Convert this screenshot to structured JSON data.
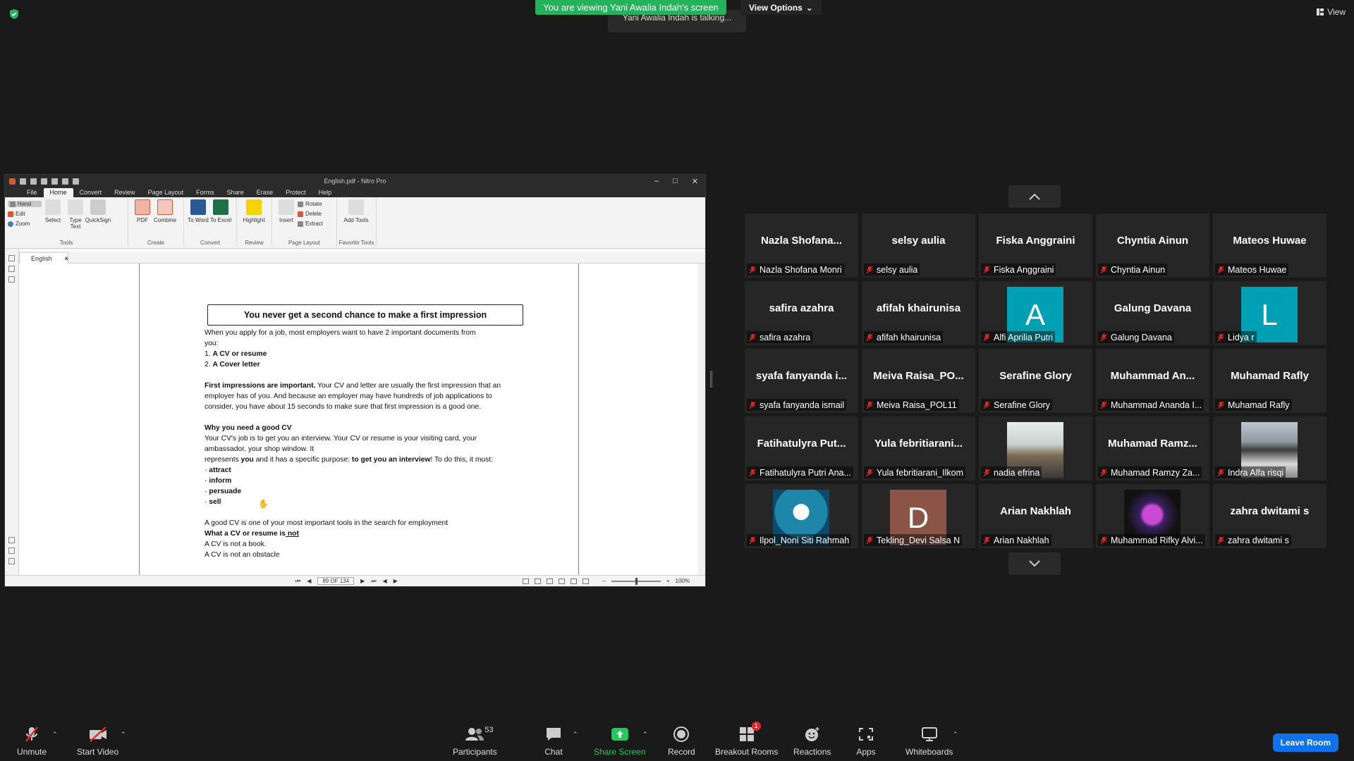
{
  "banner": {
    "viewing": "You are viewing Yani Awalia Indah's screen",
    "view_options": "View Options",
    "talking": "Yani Awalia Indah is talking...",
    "view": "View"
  },
  "nitro": {
    "title": "English.pdf - Nitro Pro",
    "menu_tabs": [
      "File",
      "Home",
      "Convert",
      "Review",
      "Page Layout",
      "Forms",
      "Share",
      "Erase",
      "Protect",
      "Help"
    ],
    "tools": {
      "hand": "Hand",
      "edit": "Edit",
      "zoom": "Zoom",
      "select": "Select",
      "type_text": "Type Text",
      "quicksign": "QuickSign",
      "tools_group": "Tools",
      "pdf": "PDF",
      "combine": "Combine",
      "create_group": "Create",
      "to_word": "To Word",
      "to_excel": "To Excel",
      "convert_group": "Convert",
      "highlight": "Highlight",
      "review_group": "Review",
      "insert": "Insert",
      "rotate": "Rotate",
      "delete": "Delete",
      "extract": "Extract",
      "page_layout_group": "Page Layout",
      "add_tools": "Add Tools",
      "favorite_group": "Favorite Tools"
    },
    "doc_tab": "English",
    "doc": {
      "heading": "You never get a second chance to make a first impression",
      "intro1": "When you apply for a job, most employers want to have 2 important documents from",
      "intro2": "you:",
      "item1_num": "1. ",
      "item1": "A CV or resume",
      "item2_num": "2. ",
      "item2": "A Cover letter",
      "fi_bold": "First impressions are important.",
      "fi_rest": " Your CV and letter are usually the first impression that an",
      "fi2": "employer has of you. And because an employer may have hundreds of job applications to",
      "fi3": "consider, you have about 15 seconds to make sure that first impression is a good one.",
      "why": "Why you need a good CV",
      "why1": "Your CV's job is to get you an interview. Your CV or resume is your visiting card, your",
      "why2": "ambassador, your shop window. It",
      "why3a": "represents ",
      "why3b": "you",
      "why3c": " and it has a specific purpose: ",
      "why3d": "to get you an interview",
      "why3e": "! To do this, it must:",
      "b1": "attract",
      "b2": "inform",
      "b3": "persuade",
      "b4": "sell",
      "good_cv": "A good CV is one of your most important tools in the search for employment",
      "what_a": "What a CV or resume is",
      "what_b": " not",
      "not_book": "A CV is not a book.",
      "not_obstacle": "A CV is not an obstacle"
    },
    "status": {
      "page": "89 OF 134",
      "zoom": "100%"
    }
  },
  "participants_tiles": [
    {
      "display": "Nazla  Shofana...",
      "label": "Nazla Shofana Monri"
    },
    {
      "display": "selsy aulia",
      "label": "selsy aulia"
    },
    {
      "display": "Fiska Anggraini",
      "label": "Fiska Anggraini"
    },
    {
      "display": "Chyntia Ainun",
      "label": "Chyntia Ainun"
    },
    {
      "display": "Mateos Huwae",
      "label": "Mateos Huwae"
    },
    {
      "display": "safira azahra",
      "label": "safira azahra"
    },
    {
      "display": "afifah khairunisa",
      "label": "afifah khairunisa"
    },
    {
      "avatar": "A",
      "label": "Alfi Aprilia Putri"
    },
    {
      "display": "Galung Davana",
      "label": "Galung Davana"
    },
    {
      "avatar": "L",
      "label": "Lidya r"
    },
    {
      "display": "syafa fanyanda i...",
      "label": "syafa fanyanda ismail"
    },
    {
      "display": "Meiva  Raisa_PO...",
      "label": "Meiva Raisa_POL11"
    },
    {
      "display": "Serafine Glory",
      "label": "Serafine Glory"
    },
    {
      "display": "Muhammad  An...",
      "label": "Muhammad Ananda I..."
    },
    {
      "display": "Muhamad Rafly",
      "label": "Muhamad Rafly"
    },
    {
      "display": "Fatihatulyra  Put...",
      "label": "Fatihatulyra Putri Ana..."
    },
    {
      "display": "Yula  febritiarani...",
      "label": "Yula febritiarani_Ilkom"
    },
    {
      "photo": "photo-woman",
      "label": "nadia efrina"
    },
    {
      "display": "Muhamad  Ramz...",
      "label": "Muhamad Ramzy Za..."
    },
    {
      "photo": "photo-statue",
      "label": "Indra Alfa risqi"
    },
    {
      "photo": "photo-moon-city",
      "label": "Ilpol_Noni Siti Rahmah"
    },
    {
      "avatar": "D",
      "label": "Tekling_Devi Salsa N"
    },
    {
      "display": "Arian Nakhlah",
      "label": "Arian Nakhlah"
    },
    {
      "photo": "photo-skull",
      "label": "Muhammad Rifky Alvi..."
    },
    {
      "display": "zahra dwitami s",
      "label": "zahra dwitami s"
    }
  ],
  "toolbar": {
    "unmute": "Unmute",
    "start_video": "Start Video",
    "participants": "Participants",
    "participants_count": "53",
    "chat": "Chat",
    "share_screen": "Share Screen",
    "record": "Record",
    "breakout_rooms": "Breakout Rooms",
    "breakout_badge": "1",
    "reactions": "Reactions",
    "apps": "Apps",
    "whiteboards": "Whiteboards",
    "leave": "Leave Room"
  },
  "colors": {
    "green_banner": "#23b35b",
    "leave_blue": "#0e72ed",
    "avatar_teal": "#00a0b4",
    "avatar_brown": "#8c5446",
    "mic_red": "#e02828"
  }
}
